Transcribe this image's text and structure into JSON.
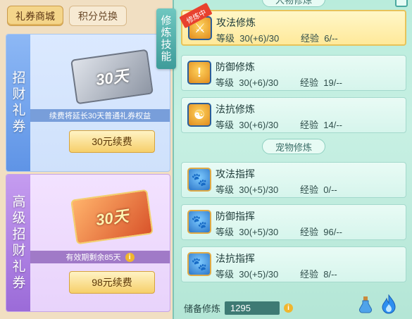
{
  "left": {
    "tabs": [
      {
        "label": "礼券商城",
        "active": true
      },
      {
        "label": "积分兑换",
        "active": false
      }
    ],
    "cards": [
      {
        "side_label": "招财礼券",
        "ticket_text": "30天",
        "note": "续费将延长30天普通礼券权益",
        "button": "30元续费"
      },
      {
        "side_label": "高级招财礼券",
        "ticket_text": "30天",
        "note": "有效期剩余85天",
        "button": "98元续费"
      }
    ]
  },
  "vertical_title": "修炼技能",
  "right": {
    "section_character": "人物修炼",
    "section_pet": "宠物修炼",
    "active_badge": "修炼中",
    "character_skills": [
      {
        "name": "攻法修炼",
        "level_label": "等级",
        "level": "30(+6)/30",
        "exp_label": "经验",
        "exp": "6/--",
        "active": true
      },
      {
        "name": "防御修炼",
        "level_label": "等级",
        "level": "30(+6)/30",
        "exp_label": "经验",
        "exp": "19/--",
        "active": false
      },
      {
        "name": "法抗修炼",
        "level_label": "等级",
        "level": "30(+6)/30",
        "exp_label": "经验",
        "exp": "14/--",
        "active": false
      }
    ],
    "pet_skills": [
      {
        "name": "攻法指挥",
        "level_label": "等级",
        "level": "30(+5)/30",
        "exp_label": "经验",
        "exp": "0/--"
      },
      {
        "name": "防御指挥",
        "level_label": "等级",
        "level": "30(+5)/30",
        "exp_label": "经验",
        "exp": "96/--"
      },
      {
        "name": "法抗指挥",
        "level_label": "等级",
        "level": "30(+5)/30",
        "exp_label": "经验",
        "exp": "8/--"
      }
    ],
    "reserve_label": "储备修炼",
    "reserve_value": "1295",
    "icons": [
      "potion-icon",
      "flame-icon",
      "info-icon"
    ]
  },
  "colors": {
    "accent_teal": "#3e9c9a",
    "gold_button": "#f6cf6a",
    "active_ribbon": "#e8412e"
  }
}
